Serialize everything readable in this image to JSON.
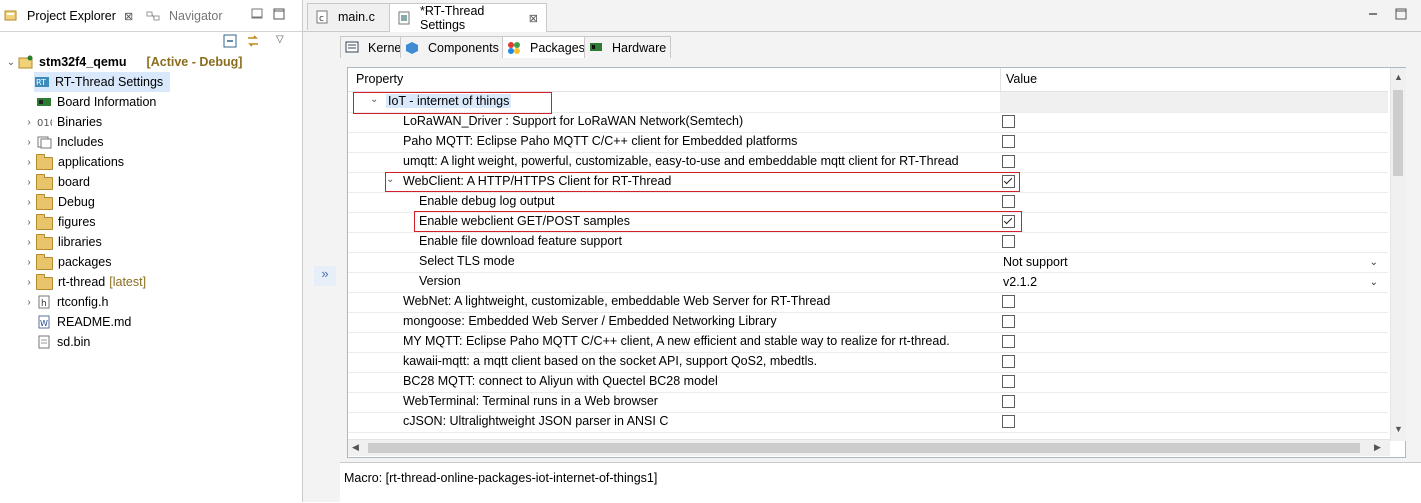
{
  "left": {
    "tabs": [
      {
        "label": "Project Explorer",
        "close": "⊠"
      },
      {
        "label": "Navigator"
      }
    ],
    "project": {
      "name": "stm32f4_qemu",
      "status": "[Active - Debug]"
    },
    "items": [
      {
        "label": "RT-Thread Settings"
      },
      {
        "label": "Board Information"
      },
      {
        "label": "Binaries"
      },
      {
        "label": "Includes"
      },
      {
        "label": "applications"
      },
      {
        "label": "board"
      },
      {
        "label": "Debug"
      },
      {
        "label": "figures"
      },
      {
        "label": "libraries"
      },
      {
        "label": "packages"
      },
      {
        "label": "rt-thread",
        "badge": "[latest]"
      },
      {
        "label": "rtconfig.h"
      },
      {
        "label": "README.md"
      },
      {
        "label": "sd.bin"
      }
    ]
  },
  "editor": {
    "tabs": [
      {
        "label": "main.c"
      },
      {
        "label": "*RT-Thread Settings",
        "close": "⊠"
      }
    ],
    "subtabs": [
      {
        "label": "Kernel"
      },
      {
        "label": "Components"
      },
      {
        "label": "Packages"
      },
      {
        "label": "Hardware"
      }
    ],
    "table": {
      "header": {
        "property": "Property",
        "value": "Value"
      },
      "rows": [
        {
          "label": "IoT - internet of things"
        },
        {
          "label": "LoRaWAN_Driver : Support for LoRaWAN Network(Semtech)",
          "checked": false
        },
        {
          "label": "Paho MQTT: Eclipse Paho MQTT C/C++ client for Embedded platforms",
          "checked": false
        },
        {
          "label": "umqtt: A light weight, powerful, customizable, easy-to-use and embeddable mqtt client for RT-Thread",
          "checked": false
        },
        {
          "label": "WebClient: A HTTP/HTTPS Client for RT-Thread",
          "checked": true
        },
        {
          "label": "Enable debug log output",
          "checked": false
        },
        {
          "label": "Enable webclient GET/POST samples",
          "checked": true
        },
        {
          "label": "Enable file download feature support",
          "checked": false
        },
        {
          "label": "Select TLS mode",
          "value": "Not support"
        },
        {
          "label": "Version",
          "value": "v2.1.2"
        },
        {
          "label": "WebNet: A lightweight, customizable, embeddable Web Server for RT-Thread",
          "checked": false
        },
        {
          "label": "mongoose: Embedded Web Server / Embedded Networking Library",
          "checked": false
        },
        {
          "label": "MY MQTT:  Eclipse Paho MQTT C/C++ client, A new efficient and stable way to realize for rt-thread.",
          "checked": false
        },
        {
          "label": "kawaii-mqtt: a mqtt client based on the socket API, support QoS2, mbedtls.",
          "checked": false
        },
        {
          "label": "BC28 MQTT: connect to Aliyun with Quectel BC28 model",
          "checked": false
        },
        {
          "label": "WebTerminal: Terminal runs in a Web browser",
          "checked": false
        },
        {
          "label": "cJSON: Ultralightweight JSON parser in ANSI C",
          "checked": false
        }
      ]
    },
    "macro": "Macro: [rt-thread-online-packages-iot-internet-of-things1]"
  },
  "colors": {
    "highlight_box": "#d2202a",
    "selection": "#d9e9fb"
  },
  "icons": [
    "close-icon",
    "collapse-all-icon",
    "link-editor-icon",
    "view-menu-icon",
    "minimize-icon",
    "maximize-icon",
    "folder-icon",
    "file-icon",
    "checkbox-icon",
    "chevron-down-icon"
  ]
}
